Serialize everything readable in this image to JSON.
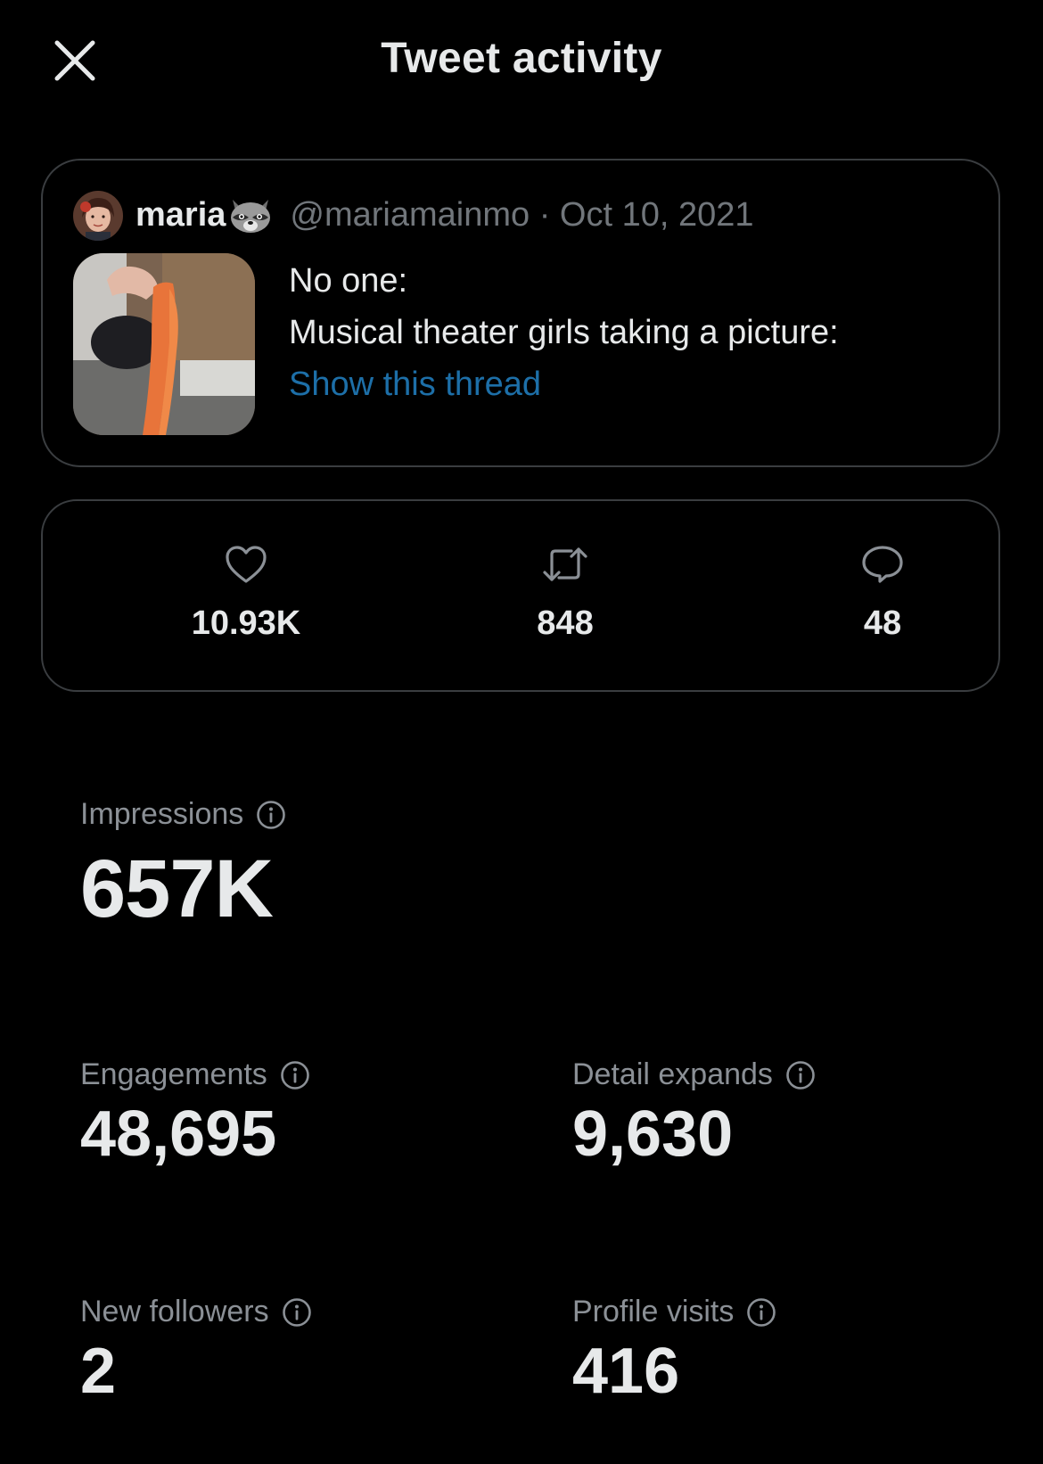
{
  "header": {
    "title": "Tweet activity"
  },
  "tweet": {
    "author_name": "maria",
    "handle_date": "@mariamainmo · Oct 10, 2021",
    "lines": [
      "No one:",
      "Musical theater girls taking a picture:"
    ],
    "show_thread": "Show this thread"
  },
  "engagement_counts": {
    "likes": "10.93K",
    "retweets": "848",
    "replies": "48"
  },
  "metrics": {
    "impressions": {
      "label": "Impressions",
      "value": "657K"
    },
    "engagements": {
      "label": "Engagements",
      "value": "48,695"
    },
    "detail_expands": {
      "label": "Detail expands",
      "value": "9,630"
    },
    "new_followers": {
      "label": "New followers",
      "value": "2"
    },
    "profile_visits": {
      "label": "Profile visits",
      "value": "416"
    }
  },
  "icons": {
    "close": "close-icon",
    "like": "heart-icon",
    "retweet": "retweet-icon",
    "reply": "reply-icon",
    "info": "info-icon",
    "emoji": "raccoon-emoji"
  },
  "colors": {
    "background": "#000000",
    "text": "#e7e9ea",
    "muted": "#8b9096",
    "link": "#1d6fa8",
    "border": "#3a3d40"
  }
}
